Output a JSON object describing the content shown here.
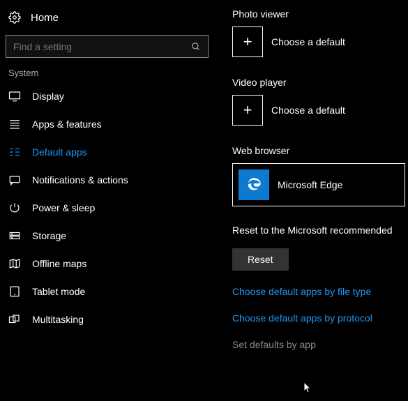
{
  "header": {
    "home_label": "Home"
  },
  "search": {
    "placeholder": "Find a setting",
    "value": ""
  },
  "sidebar": {
    "section_label": "System",
    "items": [
      {
        "icon": "display-icon",
        "label": "Display"
      },
      {
        "icon": "apps-icon",
        "label": "Apps & features"
      },
      {
        "icon": "defaults-icon",
        "label": "Default apps",
        "active": true
      },
      {
        "icon": "notifications-icon",
        "label": "Notifications & actions"
      },
      {
        "icon": "power-icon",
        "label": "Power & sleep"
      },
      {
        "icon": "storage-icon",
        "label": "Storage"
      },
      {
        "icon": "maps-icon",
        "label": "Offline maps"
      },
      {
        "icon": "tablet-icon",
        "label": "Tablet mode"
      },
      {
        "icon": "multitask-icon",
        "label": "Multitasking"
      }
    ]
  },
  "content": {
    "photo_viewer": {
      "title": "Photo viewer",
      "action": "Choose a default"
    },
    "video_player": {
      "title": "Video player",
      "action": "Choose a default"
    },
    "web_browser": {
      "title": "Web browser",
      "selected": "Microsoft Edge"
    },
    "reset": {
      "label": "Reset to the Microsoft recommended",
      "button": "Reset"
    },
    "links": {
      "by_file_type": "Choose default apps by file type",
      "by_protocol": "Choose default apps by protocol",
      "by_app": "Set defaults by app"
    }
  },
  "colors": {
    "accent": "#2196f3",
    "edge_tile": "#0b7ad1"
  }
}
